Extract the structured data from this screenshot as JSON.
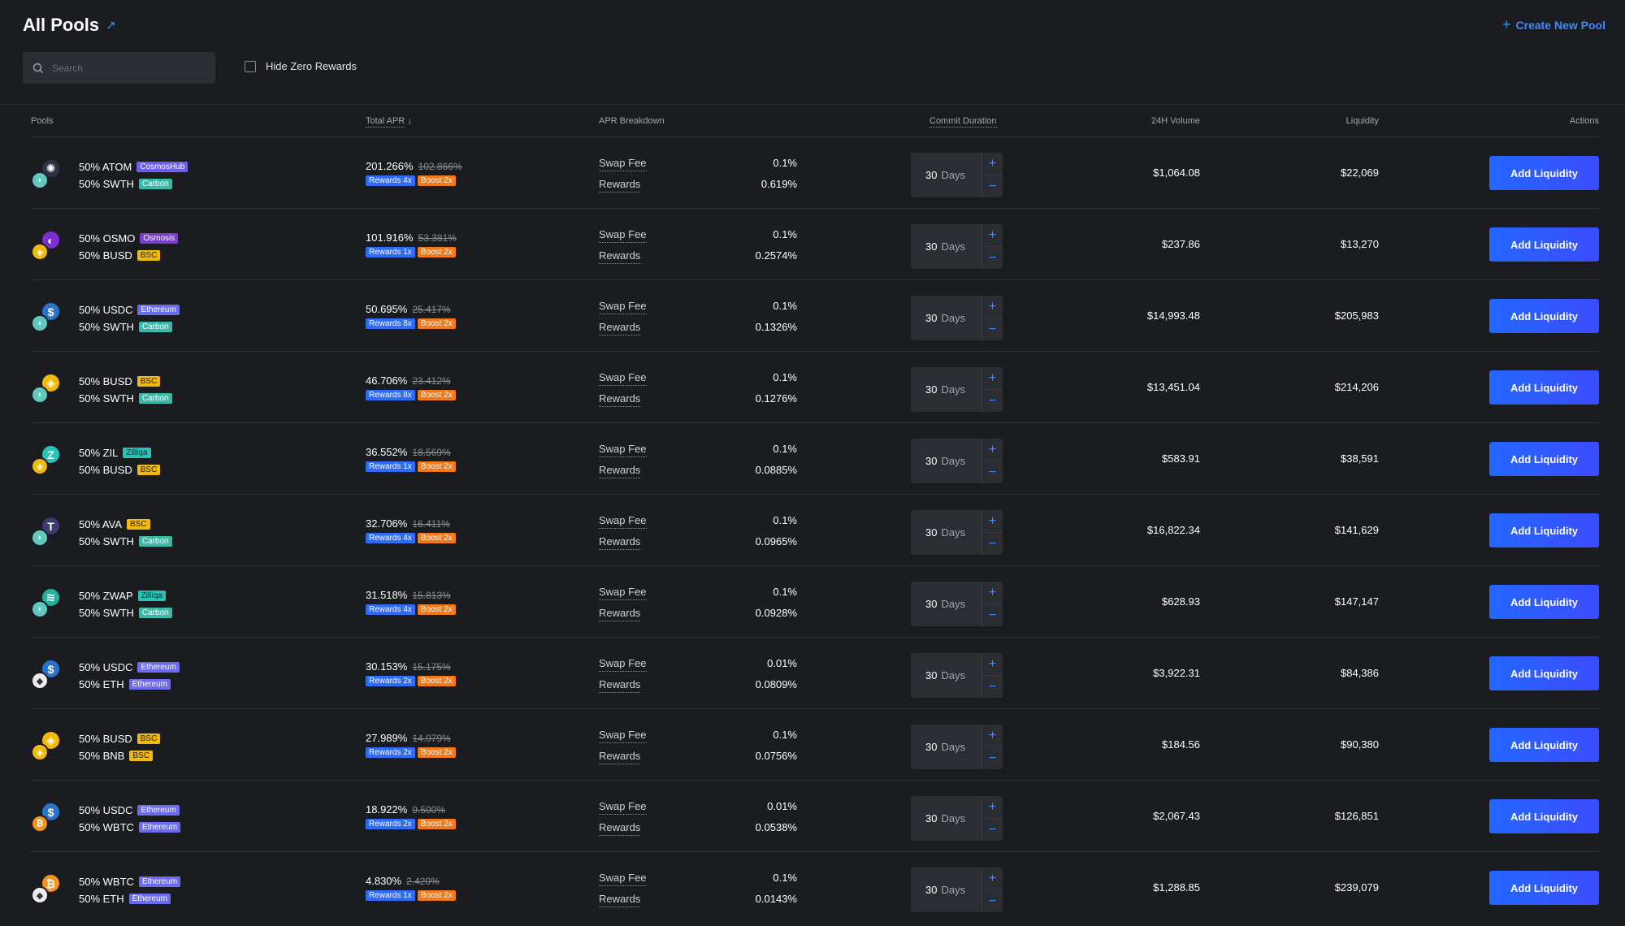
{
  "header": {
    "title": "All Pools",
    "create_label": "Create New Pool"
  },
  "search": {
    "placeholder": "Search"
  },
  "filter": {
    "hide_zero_label": "Hide Zero Rewards"
  },
  "columns": {
    "pools": "Pools",
    "total_apr": "Total APR",
    "apr_breakdown": "APR Breakdown",
    "commit_duration": "Commit Duration",
    "volume": "24H Volume",
    "liquidity": "Liquidity",
    "actions": "Actions"
  },
  "labels": {
    "swap_fee": "Swap Fee",
    "rewards": "Rewards",
    "days_unit": "Days",
    "add_liquidity": "Add Liquidity"
  },
  "rows": [
    {
      "t1": "50% ATOM",
      "c1": "CosmosHub",
      "c1k": "cosmoshub",
      "t2": "50% SWTH",
      "c2": "Carbon",
      "c2k": "carbon",
      "i1": "atom",
      "i2": "swth",
      "apr": "201.266%",
      "apr_old": "102.866%",
      "rewards": "Rewards 4x",
      "boost": "Boost 2x",
      "swap_fee": "0.1%",
      "reward_pct": "0.619%",
      "days": "30",
      "volume": "$1,064.08",
      "liquidity": "$22,069"
    },
    {
      "t1": "50% OSMO",
      "c1": "Osmosis",
      "c1k": "osmosis",
      "t2": "50% BUSD",
      "c2": "BSC",
      "c2k": "bsc",
      "i1": "osmo",
      "i2": "busd",
      "apr": "101.916%",
      "apr_old": "53.381%",
      "rewards": "Rewards 1x",
      "boost": "Boost 2x",
      "swap_fee": "0.1%",
      "reward_pct": "0.2574%",
      "days": "30",
      "volume": "$237.86",
      "liquidity": "$13,270"
    },
    {
      "t1": "50% USDC",
      "c1": "Ethereum",
      "c1k": "ethereum",
      "t2": "50% SWTH",
      "c2": "Carbon",
      "c2k": "carbon",
      "i1": "usdc",
      "i2": "swth",
      "apr": "50.695%",
      "apr_old": "25.417%",
      "rewards": "Rewards 8x",
      "boost": "Boost 2x",
      "swap_fee": "0.1%",
      "reward_pct": "0.1326%",
      "days": "30",
      "volume": "$14,993.48",
      "liquidity": "$205,983"
    },
    {
      "t1": "50% BUSD",
      "c1": "BSC",
      "c1k": "bsc",
      "t2": "50% SWTH",
      "c2": "Carbon",
      "c2k": "carbon",
      "i1": "busd",
      "i2": "swth",
      "apr": "46.706%",
      "apr_old": "23.412%",
      "rewards": "Rewards 8x",
      "boost": "Boost 2x",
      "swap_fee": "0.1%",
      "reward_pct": "0.1276%",
      "days": "30",
      "volume": "$13,451.04",
      "liquidity": "$214,206"
    },
    {
      "t1": "50% ZIL",
      "c1": "Zilliqa",
      "c1k": "zilliqa",
      "t2": "50% BUSD",
      "c2": "BSC",
      "c2k": "bsc",
      "i1": "zil",
      "i2": "busd",
      "apr": "36.552%",
      "apr_old": "18.569%",
      "rewards": "Rewards 1x",
      "boost": "Boost 2x",
      "swap_fee": "0.1%",
      "reward_pct": "0.0885%",
      "days": "30",
      "volume": "$583.91",
      "liquidity": "$38,591"
    },
    {
      "t1": "50% AVA",
      "c1": "BSC",
      "c1k": "bsc",
      "t2": "50% SWTH",
      "c2": "Carbon",
      "c2k": "carbon",
      "i1": "ava",
      "i2": "swth",
      "apr": "32.706%",
      "apr_old": "16.411%",
      "rewards": "Rewards 4x",
      "boost": "Boost 2x",
      "swap_fee": "0.1%",
      "reward_pct": "0.0965%",
      "days": "30",
      "volume": "$16,822.34",
      "liquidity": "$141,629"
    },
    {
      "t1": "50% ZWAP",
      "c1": "Zilliqa",
      "c1k": "zilliqa",
      "t2": "50% SWTH",
      "c2": "Carbon",
      "c2k": "carbon",
      "i1": "zwap",
      "i2": "swth",
      "apr": "31.518%",
      "apr_old": "15.813%",
      "rewards": "Rewards 4x",
      "boost": "Boost 2x",
      "swap_fee": "0.1%",
      "reward_pct": "0.0928%",
      "days": "30",
      "volume": "$628.93",
      "liquidity": "$147,147"
    },
    {
      "t1": "50% USDC",
      "c1": "Ethereum",
      "c1k": "ethereum",
      "t2": "50% ETH",
      "c2": "Ethereum",
      "c2k": "ethereum",
      "i1": "usdc",
      "i2": "eth",
      "apr": "30.153%",
      "apr_old": "15.175%",
      "rewards": "Rewards 2x",
      "boost": "Boost 2x",
      "swap_fee": "0.01%",
      "reward_pct": "0.0809%",
      "days": "30",
      "volume": "$3,922.31",
      "liquidity": "$84,386"
    },
    {
      "t1": "50% BUSD",
      "c1": "BSC",
      "c1k": "bsc",
      "t2": "50% BNB",
      "c2": "BSC",
      "c2k": "bsc",
      "i1": "busd",
      "i2": "bnb",
      "apr": "27.989%",
      "apr_old": "14.079%",
      "rewards": "Rewards 2x",
      "boost": "Boost 2x",
      "swap_fee": "0.1%",
      "reward_pct": "0.0756%",
      "days": "30",
      "volume": "$184.56",
      "liquidity": "$90,380"
    },
    {
      "t1": "50% USDC",
      "c1": "Ethereum",
      "c1k": "ethereum",
      "t2": "50% WBTC",
      "c2": "Ethereum",
      "c2k": "ethereum",
      "i1": "usdc",
      "i2": "wbtc",
      "apr": "18.922%",
      "apr_old": "9.500%",
      "rewards": "Rewards 2x",
      "boost": "Boost 2x",
      "swap_fee": "0.01%",
      "reward_pct": "0.0538%",
      "days": "30",
      "volume": "$2,067.43",
      "liquidity": "$126,851"
    },
    {
      "t1": "50% WBTC",
      "c1": "Ethereum",
      "c1k": "ethereum",
      "t2": "50% ETH",
      "c2": "Ethereum",
      "c2k": "ethereum",
      "i1": "wbtc",
      "i2": "eth",
      "apr": "4.830%",
      "apr_old": "2.420%",
      "rewards": "Rewards 1x",
      "boost": "Boost 2x",
      "swap_fee": "0.1%",
      "reward_pct": "0.0143%",
      "days": "30",
      "volume": "$1,288.85",
      "liquidity": "$239,079"
    }
  ],
  "coin_styles": {
    "atom": {
      "bg": "#2e3148",
      "glyph": "✺"
    },
    "swth": {
      "bg": "#5fc9c0",
      "glyph": "◗"
    },
    "osmo": {
      "bg": "#7b2fd1",
      "glyph": "◐"
    },
    "busd": {
      "bg": "#f0b90b",
      "glyph": "◈"
    },
    "usdc": {
      "bg": "#2775ca",
      "glyph": "$"
    },
    "zil": {
      "bg": "#29c4b8",
      "glyph": "Z"
    },
    "ava": {
      "bg": "#3c3c6e",
      "glyph": "T"
    },
    "zwap": {
      "bg": "#1fb39b",
      "glyph": "≋"
    },
    "eth": {
      "bg": "#ececec",
      "glyph": "◆"
    },
    "bnb": {
      "bg": "#f0b90b",
      "glyph": "◈"
    },
    "wbtc": {
      "bg": "#f7931a",
      "glyph": "₿"
    }
  }
}
